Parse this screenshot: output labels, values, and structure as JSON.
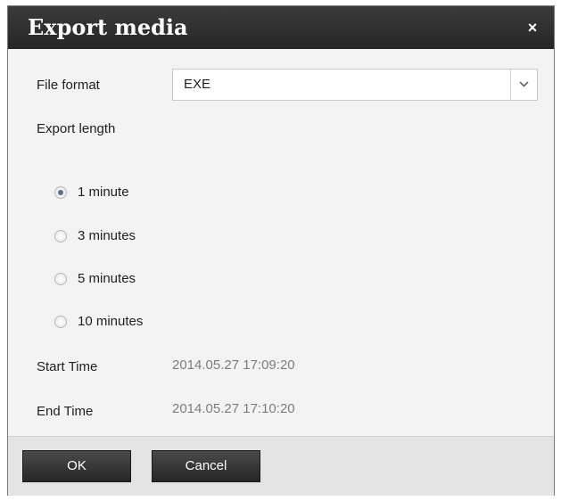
{
  "dialog": {
    "title": "Export media",
    "close_glyph": "×",
    "close_icon": "close-icon"
  },
  "form": {
    "file_format_label": "File format",
    "file_format_value": "EXE",
    "export_length_label": "Export length",
    "options": [
      "1 minute",
      "3 minutes",
      "5 minutes",
      "10 minutes"
    ],
    "selected_option": "1 minute",
    "start_time_label": "Start Time",
    "start_time_value": "2014.05.27 17:09:20",
    "end_time_label": "End Time",
    "end_time_value": "2014.05.27 17:10:20"
  },
  "footer": {
    "ok_label": "OK",
    "cancel_label": "Cancel"
  },
  "colors": {
    "titlebar": "#2b2b2b",
    "button": "#333333",
    "body_background": "#f3f3f3"
  }
}
